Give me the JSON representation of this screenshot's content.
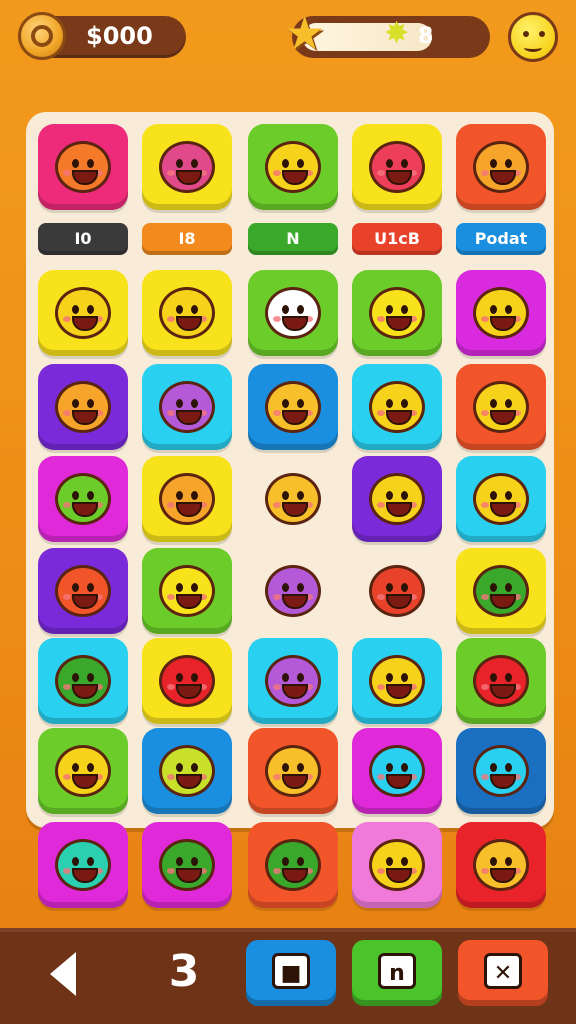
{
  "hud": {
    "coins": "$000",
    "stars": "8",
    "icons": {
      "coin": "coin-icon",
      "star": "star-icon",
      "star_count": "star-badge-icon",
      "avatar": "player-avatar-icon"
    }
  },
  "board": {
    "labels": [
      {
        "text": "I0",
        "color": "#3a3a3a"
      },
      {
        "text": "I8",
        "color": "#f28a1e"
      },
      {
        "text": "N",
        "color": "#3aa82a"
      },
      {
        "text": "U1cB",
        "color": "#e8432a"
      },
      {
        "text": "Podat",
        "color": "#1a8fe0"
      }
    ],
    "rows": [
      [
        {
          "bg": "#ee2a7b",
          "face": "#f47a2a",
          "icon": "orange-blob-face-icon"
        },
        {
          "bg": "#f7e21b",
          "face": "#e04a8a",
          "icon": "pink-teal-shield-icon"
        },
        {
          "bg": "#6ccd2a",
          "face": "#f7d21b",
          "icon": "yellow-lion-face-icon"
        },
        {
          "bg": "#f7e21b",
          "face": "#ee3f5a",
          "icon": "red-smile-face-icon"
        },
        {
          "bg": "#f2552a",
          "face": "#f7a52a",
          "icon": "orange-leaf-icon"
        }
      ],
      [
        {
          "bg": "#f7e21b",
          "face": "#f7d21b",
          "icon": "yellow-cat-face-icon"
        },
        {
          "bg": "#f7e21b",
          "face": "#f7d21b",
          "icon": "yellow-cat-face-icon"
        },
        {
          "bg": "#6ccd2a",
          "face": "#ffffff",
          "icon": "white-cat-face-icon"
        },
        {
          "bg": "#6ccd2a",
          "face": "#f7e21b",
          "icon": "yellow-bird-hat-icon"
        },
        {
          "bg": "#d92ae0",
          "face": "#f7d21b",
          "icon": "yellow-bear-face-icon"
        }
      ],
      [
        {
          "bg": "#7a2ad9",
          "face": "#f7a52a",
          "icon": "orange-cat-face-icon"
        },
        {
          "bg": "#2ad0f0",
          "face": "#b45ad9",
          "icon": "purple-bubble-icon"
        },
        {
          "bg": "#1a8fe0",
          "face": "#f7c02a",
          "icon": "orange-bear-face-icon"
        },
        {
          "bg": "#2ad0f0",
          "face": "#f7d21b",
          "icon": "yellow-fish-face-icon"
        },
        {
          "bg": "#f2552a",
          "face": "#f7d21b",
          "icon": "yellow-star-face-icon"
        }
      ],
      [
        {
          "bg": "#e02ad9",
          "face": "#6ccd2a",
          "icon": "green-bubble-face-icon"
        },
        {
          "bg": "#f7e21b",
          "face": "#f7a52a",
          "icon": "orange-cat-bubble-icon"
        },
        {
          "bg": "transparent",
          "face": "#f7c02a",
          "icon": "sun-badge-icon"
        },
        {
          "bg": "#7a2ad9",
          "face": "#f7d21b",
          "icon": "yellow-smile-face-icon"
        },
        {
          "bg": "#2ad0f0",
          "face": "#f7d21b",
          "icon": "yellow-bird-face-icon"
        }
      ],
      [
        {
          "bg": "#7a2ad9",
          "face": "#f2552a",
          "icon": "red-fox-icon"
        },
        {
          "bg": "#6ccd2a",
          "face": "#f7e21b",
          "icon": "yellow-smile-face-icon"
        },
        {
          "bg": "transparent",
          "face": "#b45ad9",
          "icon": "purple-battery-icon"
        },
        {
          "bg": "transparent",
          "face": "#e8432a",
          "icon": "red-bird-icon"
        },
        {
          "bg": "#f7e21b",
          "face": "#3aa82a",
          "icon": "green-frog-icon"
        }
      ],
      [
        {
          "bg": "#2ad0f0",
          "face": "#3aa82a",
          "icon": "green-energy-card-icon"
        },
        {
          "bg": "#f7e21b",
          "face": "#e8232a",
          "icon": "red-cherry-icon"
        },
        {
          "bg": "#2ad0f0",
          "face": "#b45ad9",
          "icon": "purple-bubble-face-icon"
        },
        {
          "bg": "#2ad0f0",
          "face": "#f7d21b",
          "icon": "yellow-bubble-face-icon"
        },
        {
          "bg": "#6ccd2a",
          "face": "#e8232a",
          "icon": "red-apple-icon"
        }
      ],
      [
        {
          "bg": "#6ccd2a",
          "face": "#f7d21b",
          "icon": "yellow-lion-face-icon"
        },
        {
          "bg": "#1a8fe0",
          "face": "#c8e02a",
          "icon": "lime-bird-face-icon"
        },
        {
          "bg": "#f2552a",
          "face": "#f7c02a",
          "icon": "orange-sun-face-icon"
        },
        {
          "bg": "#e02ad9",
          "face": "#2ad0f0",
          "icon": "blue-star-face-icon"
        },
        {
          "bg": "#1a6fc0",
          "face": "#2ad0f0",
          "icon": "treasure-box-icon"
        }
      ],
      [
        {
          "bg": "#e02ad9",
          "face": "#2ad0b0",
          "icon": "teal-fish-face-icon"
        },
        {
          "bg": "#e02ad9",
          "face": "#3aa82a",
          "icon": "green-bubble-face-icon"
        },
        {
          "bg": "#f2552a",
          "face": "#3aa82a",
          "icon": "green-pepper-icon"
        },
        {
          "bg": "#f07ad9",
          "face": "#f7d21b",
          "icon": "yellow-smile-face-icon"
        },
        {
          "bg": "#e8232a",
          "face": "#f7c02a",
          "icon": "map-pin-icon"
        }
      ]
    ]
  },
  "footer": {
    "level": "3",
    "buttons": [
      {
        "id": "stop",
        "glyph": "■",
        "color": "#1a8fe0",
        "icon": "stop-icon"
      },
      {
        "id": "pause",
        "glyph": "n",
        "color": "#4ac42a",
        "icon": "pause-icon"
      },
      {
        "id": "close",
        "glyph": "✕",
        "color": "#f2552a",
        "icon": "close-icon"
      }
    ]
  }
}
